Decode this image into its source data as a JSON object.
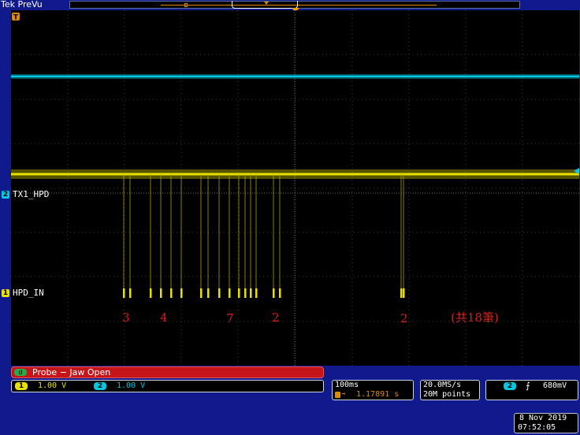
{
  "header": {
    "brand": "Tek",
    "mode": "PreVu"
  },
  "colors": {
    "ch1": "#e8e000",
    "ch2": "#00c8e0",
    "probe_bar": "#c6141b",
    "annotation": "#d4201c",
    "background": "#101a8c"
  },
  "channels": [
    {
      "number": "1",
      "label": "HPD_IN",
      "scale": "1.00 V"
    },
    {
      "number": "2",
      "label": "TX1_HPD",
      "scale": "1.00 V"
    }
  ],
  "probe_status": {
    "badge": "d",
    "text": "Probe − Jaw Open"
  },
  "timebase": {
    "scale": "100ms",
    "position": "1.17891 s"
  },
  "acquisition": {
    "sample_rate": "20.0MS/s",
    "record_length": "20M points"
  },
  "trigger": {
    "channel": "2",
    "level": "680mV"
  },
  "annotations": {
    "counts": [
      "3",
      "4",
      "7",
      "2",
      "2"
    ],
    "total": "(共18筆)"
  },
  "datetime": {
    "date": "8 Nov 2019",
    "time": "07:52:05"
  }
}
